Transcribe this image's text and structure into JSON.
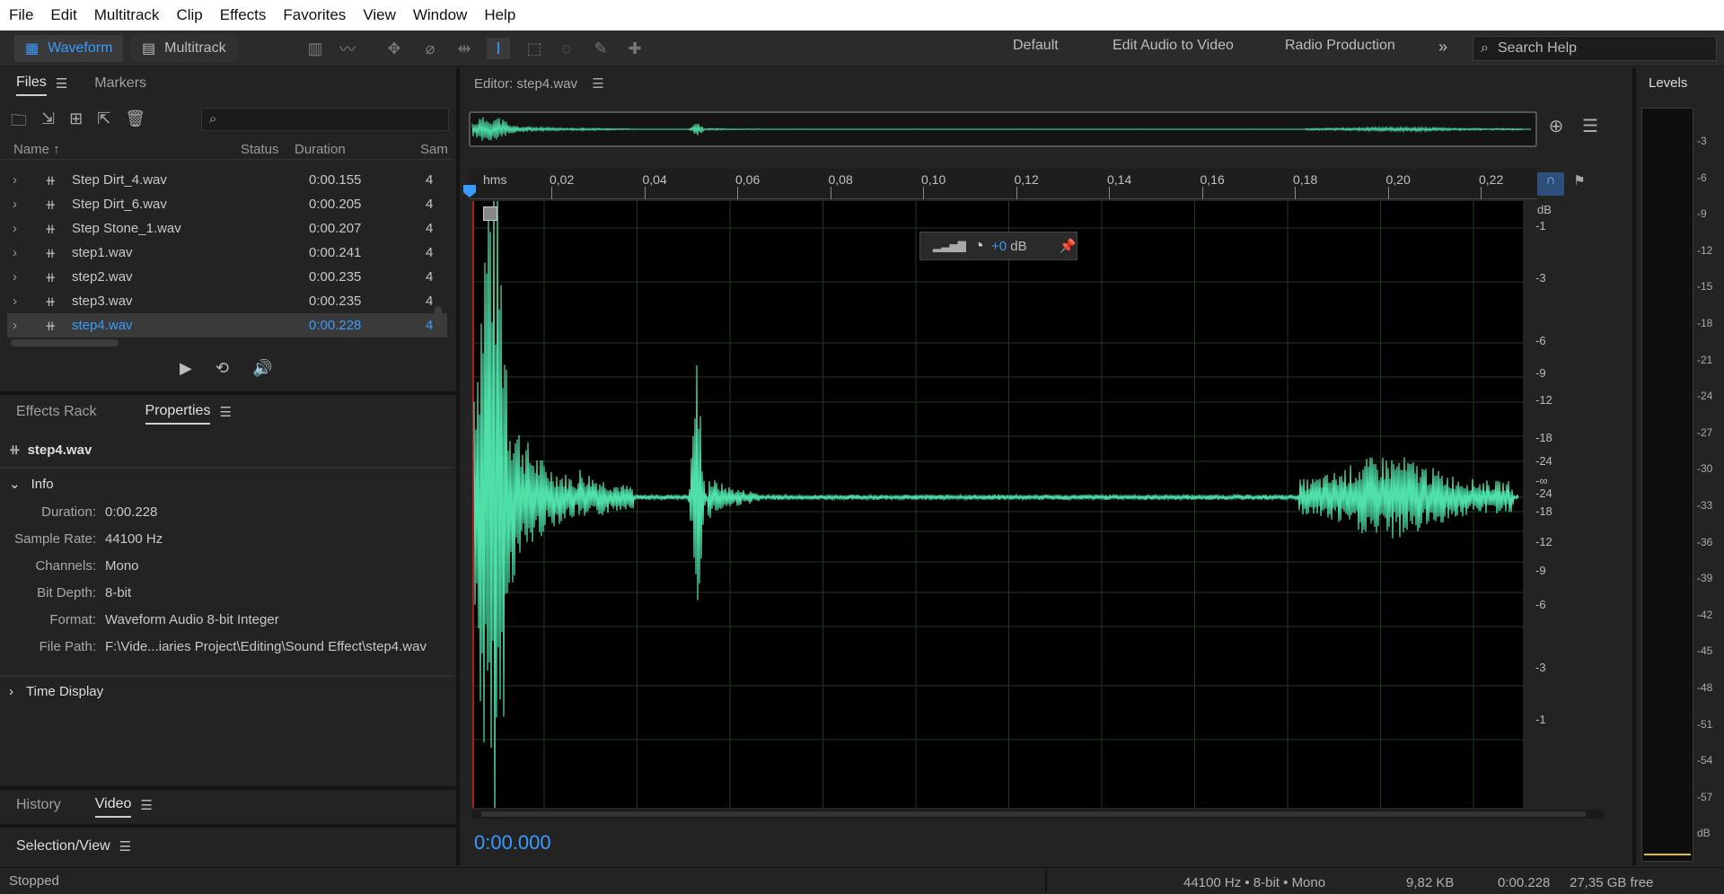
{
  "menu": [
    "File",
    "Edit",
    "Multitrack",
    "Clip",
    "Effects",
    "Favorites",
    "View",
    "Window",
    "Help"
  ],
  "toolbar": {
    "waveform_label": "Waveform",
    "multitrack_label": "Multitrack",
    "workspaces": [
      "Default",
      "Edit Audio to Video",
      "Radio Production"
    ],
    "more": "»",
    "search_placeholder": "Search Help"
  },
  "files_panel": {
    "tabs": [
      "Files",
      "Markers"
    ],
    "columns": {
      "name": "Name",
      "status": "Status",
      "duration": "Duration",
      "sample": "Sam"
    },
    "rows": [
      {
        "name": "Step Dirt_4.wav",
        "duration": "0:00.155",
        "sample": "4"
      },
      {
        "name": "Step Dirt_6.wav",
        "duration": "0:00.205",
        "sample": "4"
      },
      {
        "name": "Step Stone_1.wav",
        "duration": "0:00.207",
        "sample": "4"
      },
      {
        "name": "step1.wav",
        "duration": "0:00.241",
        "sample": "4"
      },
      {
        "name": "step2.wav",
        "duration": "0:00.235",
        "sample": "4"
      },
      {
        "name": "step3.wav",
        "duration": "0:00.235",
        "sample": "4"
      },
      {
        "name": "step4.wav",
        "duration": "0:00.228",
        "sample": "4"
      }
    ]
  },
  "properties_panel": {
    "tabs": [
      "Effects Rack",
      "Properties"
    ],
    "file_name": "step4.wav",
    "info_heading": "Info",
    "info": [
      {
        "label": "Duration:",
        "value": "0:00.228"
      },
      {
        "label": "Sample Rate:",
        "value": "44100 Hz"
      },
      {
        "label": "Channels:",
        "value": "Mono"
      },
      {
        "label": "Bit Depth:",
        "value": "8-bit"
      },
      {
        "label": "Format:",
        "value": "Waveform Audio 8-bit Integer"
      },
      {
        "label": "File Path:",
        "value": "F:\\Vide...iaries Project\\Editing\\Sound Effect\\step4.wav"
      }
    ],
    "time_display": "Time Display"
  },
  "bottom_panel": {
    "tabs": [
      "History",
      "Video"
    ],
    "selection_view": "Selection/View"
  },
  "editor": {
    "title": "Editor: step4.wav",
    "ruler_unit": "hms",
    "ruler_ticks": [
      "0,02",
      "0,04",
      "0,06",
      "0,08",
      "0,10",
      "0,12",
      "0,14",
      "0,16",
      "0,18",
      "0,20",
      "0,22"
    ],
    "db_unit": "dB",
    "db_scale": [
      "-1",
      "-3",
      "-6",
      "-9",
      "-12",
      "-18",
      "-24",
      "-∞",
      "-24",
      "-18",
      "-12",
      "-9",
      "-6",
      "-3",
      "-1"
    ],
    "hud_gain": "+0",
    "hud_unit": "dB",
    "time": "0:00.000"
  },
  "levels": {
    "title": "Levels",
    "scale": [
      "-3",
      "-6",
      "-9",
      "-12",
      "-15",
      "-18",
      "-21",
      "-24",
      "-27",
      "-30",
      "-33",
      "-36",
      "-39",
      "-42",
      "-45",
      "-48",
      "-51",
      "-54",
      "-57",
      "dB"
    ]
  },
  "status": {
    "state": "Stopped",
    "format": "44100 Hz • 8-bit • Mono",
    "size": "9,82 KB",
    "duration": "0:00.228",
    "free": "27,35 GB free"
  },
  "colors": {
    "accent": "#3a9bff",
    "waveform": "#4fe0a8",
    "record": "#e23b3b"
  }
}
